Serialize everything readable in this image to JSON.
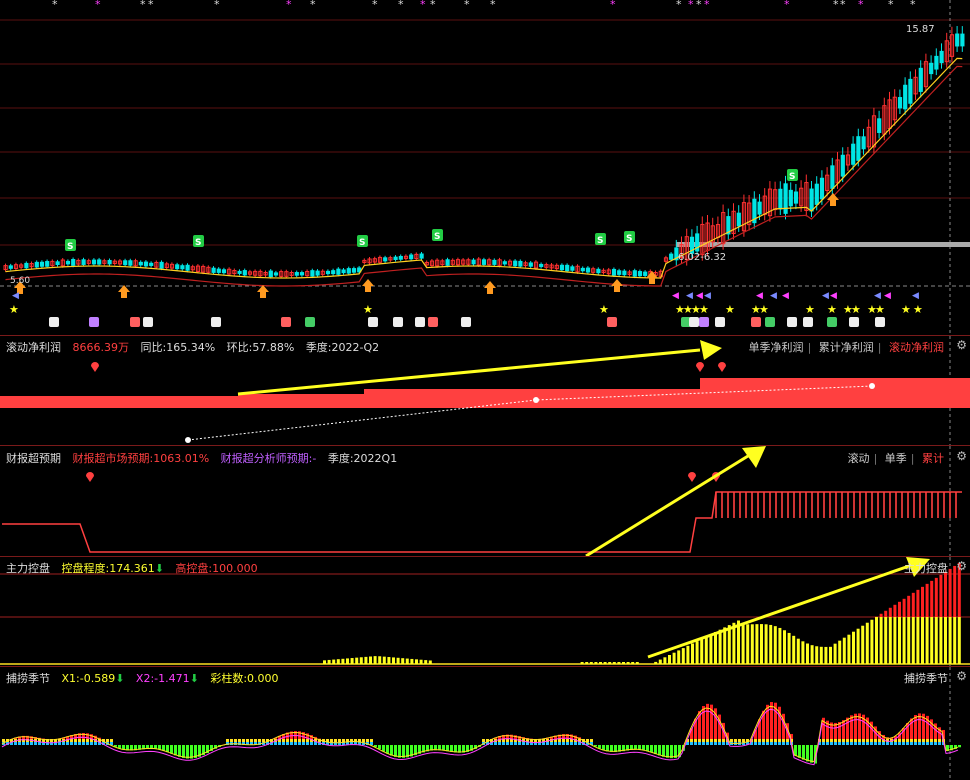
{
  "main_chart": {
    "high_label": "15.87",
    "range_label": "6.02-6.32",
    "left_label": "5.60",
    "signal_letter": "S",
    "top_marker": "*"
  },
  "panel_ttm_profit": {
    "title": "滚动净利润",
    "value": "8666.39万",
    "yoy": "同比:165.34%",
    "qoq": "环比:57.88%",
    "season": "季度:2022-Q2",
    "tabs": [
      "单季净利润",
      "累计净利润",
      "滚动净利润"
    ],
    "active_tab": 2
  },
  "panel_beat_expect": {
    "title": "财报超预期",
    "market": "财报超市场预期:1063.01%",
    "analyst": "财报超分析师预期:-",
    "season": "季度:2022Q1",
    "tabs": [
      "滚动",
      "单季",
      "累计"
    ],
    "active_tab": 2
  },
  "panel_main_control": {
    "title": "主力控盘",
    "degree": "控盘程度:174.361",
    "high": "高控盘:100.000",
    "right_label": "主力控盘"
  },
  "panel_season": {
    "title": "捕捞季节",
    "x1": "X1:-0.589",
    "x2": "X2:-1.471",
    "bars": "彩柱数:0.000",
    "right_label": "捕捞季节"
  },
  "colors": {
    "up": "#ff3030",
    "down": "#00e5e5",
    "yellow": "#ffff20",
    "magenta": "#ff40ff",
    "green": "#22cc44"
  },
  "icons": [
    "gear-icon",
    "arrow-down-icon",
    "star-icon",
    "sell-signal-icon",
    "buy-signal-icon",
    "pin-icon"
  ]
}
